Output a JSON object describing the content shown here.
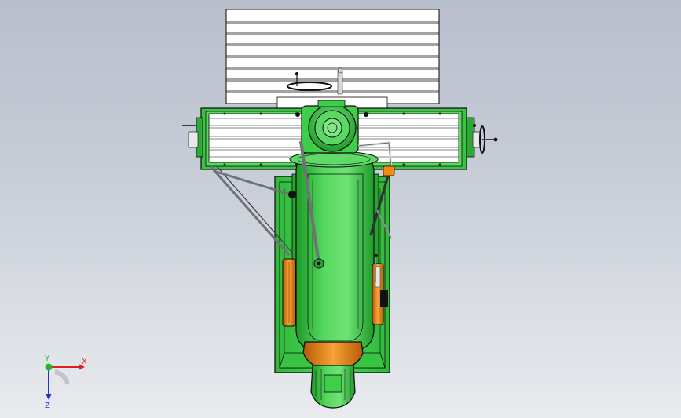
{
  "view": {
    "background_top": "#b8bfcc",
    "background_bottom": "#e9ebef"
  },
  "colors": {
    "body_green": "#3fce4a",
    "body_green_light": "#74e57a",
    "body_green_dark": "#168a22",
    "outline": "#0a0a0a",
    "orange": "#f28a14",
    "orange_dark": "#b65a05",
    "table_white": "#ffffff",
    "rod_gray": "#8a8f96"
  },
  "triad": {
    "x_label": "X",
    "y_label": "Y",
    "z_label": "Z",
    "x_color": "#e01f1f",
    "y_color": "#25b52a",
    "z_color": "#2430d4"
  }
}
